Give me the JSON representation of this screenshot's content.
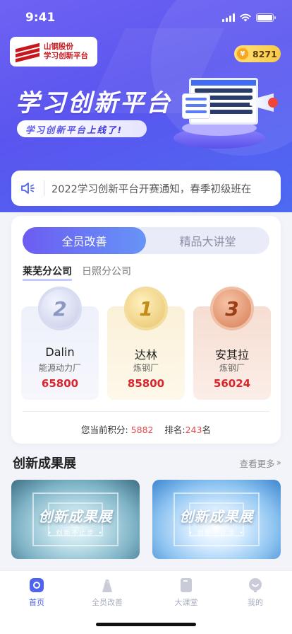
{
  "status": {
    "time": "9:41"
  },
  "logo": {
    "line1": "山钢股份",
    "line2": "学习创新平台"
  },
  "coins": {
    "value": "8271"
  },
  "banner": {
    "title": "学习创新平台",
    "sub_prefix": "学习创新平台",
    "sub_highlight": "上线了!"
  },
  "notice": {
    "text": "2022学习创新平台开赛通知，春季初级班在"
  },
  "ranking": {
    "tabs": [
      {
        "label": "全员改善"
      },
      {
        "label": "精品大讲堂"
      }
    ],
    "sub_tabs": [
      {
        "label": "莱芜分公司"
      },
      {
        "label": "日照分公司"
      }
    ],
    "podium": [
      {
        "rank": "2",
        "name": "Dalin",
        "dept": "能源动力厂",
        "score": "65800"
      },
      {
        "rank": "1",
        "name": "达林",
        "dept": "炼钢厂",
        "score": "85800"
      },
      {
        "rank": "3",
        "name": "安其拉",
        "dept": "炼钢厂",
        "score": "56024"
      }
    ],
    "my": {
      "score_label": "您当前积分:",
      "score": "5882",
      "rank_label": "排名:",
      "rank": "243",
      "rank_unit": "名"
    }
  },
  "showcase": {
    "title": "创新成果展",
    "more": "查看更多",
    "items": [
      {
        "title": "创新成果展",
        "sub": "• 创新不止步 •"
      },
      {
        "title": "创新成果展",
        "sub": "• 创新不止步 •"
      }
    ]
  },
  "tabbar": {
    "items": [
      {
        "label": "首页",
        "icon": "home-icon"
      },
      {
        "label": "全员改善",
        "icon": "improve-icon"
      },
      {
        "label": "大课堂",
        "icon": "book-icon"
      },
      {
        "label": "我的",
        "icon": "profile-icon"
      }
    ],
    "active_color": "#4e63ee"
  }
}
